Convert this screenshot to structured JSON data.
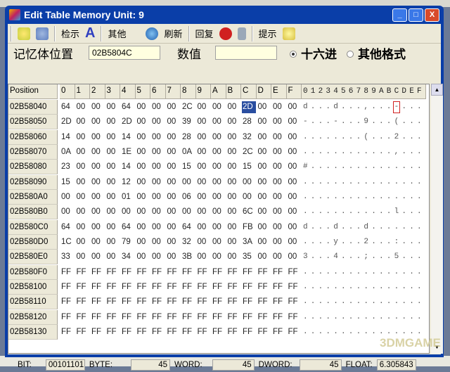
{
  "window": {
    "title": "Edit Table  Memory Unit: 9",
    "minimize": "_",
    "maximize": "□",
    "close": "X"
  },
  "toolbar": {
    "display": "检示",
    "other": "其他",
    "refresh": "刷新",
    "restore": "回复",
    "hint": "提示"
  },
  "address": {
    "label": "记忆体位置",
    "value": "02B5804C",
    "value_label": "数值",
    "value_input": "",
    "hex_label": "十六进",
    "other_format_label": "其他格式",
    "hex_selected": true
  },
  "grid": {
    "position_header": "Position",
    "hex_headers": [
      "0",
      "1",
      "2",
      "3",
      "4",
      "5",
      "6",
      "7",
      "8",
      "9",
      "A",
      "B",
      "C",
      "D",
      "E",
      "F"
    ],
    "ascii_header": "0123456789ABCDEF",
    "selected": {
      "row": 0,
      "col": 12
    },
    "rows": [
      {
        "addr": "02B58040",
        "hex": [
          "64",
          "00",
          "00",
          "00",
          "64",
          "00",
          "00",
          "00",
          "2C",
          "00",
          "00",
          "00",
          "2D",
          "00",
          "00",
          "00"
        ],
        "ascii": "d...d...,...-..."
      },
      {
        "addr": "02B58050",
        "hex": [
          "2D",
          "00",
          "00",
          "00",
          "2D",
          "00",
          "00",
          "00",
          "39",
          "00",
          "00",
          "00",
          "28",
          "00",
          "00",
          "00"
        ],
        "ascii": "-...-...9...(..."
      },
      {
        "addr": "02B58060",
        "hex": [
          "14",
          "00",
          "00",
          "00",
          "14",
          "00",
          "00",
          "00",
          "28",
          "00",
          "00",
          "00",
          "32",
          "00",
          "00",
          "00"
        ],
        "ascii": "........(...2..."
      },
      {
        "addr": "02B58070",
        "hex": [
          "0A",
          "00",
          "00",
          "00",
          "1E",
          "00",
          "00",
          "00",
          "0A",
          "00",
          "00",
          "00",
          "2C",
          "00",
          "00",
          "00"
        ],
        "ascii": "............,..."
      },
      {
        "addr": "02B58080",
        "hex": [
          "23",
          "00",
          "00",
          "00",
          "14",
          "00",
          "00",
          "00",
          "15",
          "00",
          "00",
          "00",
          "15",
          "00",
          "00",
          "00"
        ],
        "ascii": "#..............."
      },
      {
        "addr": "02B58090",
        "hex": [
          "15",
          "00",
          "00",
          "00",
          "12",
          "00",
          "00",
          "00",
          "00",
          "00",
          "00",
          "00",
          "00",
          "00",
          "00",
          "00"
        ],
        "ascii": "................"
      },
      {
        "addr": "02B580A0",
        "hex": [
          "00",
          "00",
          "00",
          "00",
          "01",
          "00",
          "00",
          "00",
          "06",
          "00",
          "00",
          "00",
          "00",
          "00",
          "00",
          "00"
        ],
        "ascii": "................"
      },
      {
        "addr": "02B580B0",
        "hex": [
          "00",
          "00",
          "00",
          "00",
          "00",
          "00",
          "00",
          "00",
          "00",
          "00",
          "00",
          "00",
          "6C",
          "00",
          "00",
          "00"
        ],
        "ascii": "............l..."
      },
      {
        "addr": "02B580C0",
        "hex": [
          "64",
          "00",
          "00",
          "00",
          "64",
          "00",
          "00",
          "00",
          "64",
          "00",
          "00",
          "00",
          "FB",
          "00",
          "00",
          "00"
        ],
        "ascii": "d...d...d......."
      },
      {
        "addr": "02B580D0",
        "hex": [
          "1C",
          "00",
          "00",
          "00",
          "79",
          "00",
          "00",
          "00",
          "32",
          "00",
          "00",
          "00",
          "3A",
          "00",
          "00",
          "00"
        ],
        "ascii": "....y...2...:..."
      },
      {
        "addr": "02B580E0",
        "hex": [
          "33",
          "00",
          "00",
          "00",
          "34",
          "00",
          "00",
          "00",
          "3B",
          "00",
          "00",
          "00",
          "35",
          "00",
          "00",
          "00"
        ],
        "ascii": "3...4...;...5..."
      },
      {
        "addr": "02B580F0",
        "hex": [
          "FF",
          "FF",
          "FF",
          "FF",
          "FF",
          "FF",
          "FF",
          "FF",
          "FF",
          "FF",
          "FF",
          "FF",
          "FF",
          "FF",
          "FF",
          "FF"
        ],
        "ascii": "................"
      },
      {
        "addr": "02B58100",
        "hex": [
          "FF",
          "FF",
          "FF",
          "FF",
          "FF",
          "FF",
          "FF",
          "FF",
          "FF",
          "FF",
          "FF",
          "FF",
          "FF",
          "FF",
          "FF",
          "FF"
        ],
        "ascii": "................"
      },
      {
        "addr": "02B58110",
        "hex": [
          "FF",
          "FF",
          "FF",
          "FF",
          "FF",
          "FF",
          "FF",
          "FF",
          "FF",
          "FF",
          "FF",
          "FF",
          "FF",
          "FF",
          "FF",
          "FF"
        ],
        "ascii": "................"
      },
      {
        "addr": "02B58120",
        "hex": [
          "FF",
          "FF",
          "FF",
          "FF",
          "FF",
          "FF",
          "FF",
          "FF",
          "FF",
          "FF",
          "FF",
          "FF",
          "FF",
          "FF",
          "FF",
          "FF"
        ],
        "ascii": "................"
      },
      {
        "addr": "02B58130",
        "hex": [
          "FF",
          "FF",
          "FF",
          "FF",
          "FF",
          "FF",
          "FF",
          "FF",
          "FF",
          "FF",
          "FF",
          "FF",
          "FF",
          "FF",
          "FF",
          "FF"
        ],
        "ascii": "................"
      }
    ]
  },
  "status": {
    "bit_label": "BIT:",
    "bit": "00101101",
    "byte_label": "BYTE:",
    "byte": "45",
    "word_label": "WORD:",
    "word": "45",
    "dword_label": "DWORD:",
    "dword": "45",
    "float_label": "FLOAT:",
    "float": "6.305843"
  },
  "watermark": "3DMGAME"
}
